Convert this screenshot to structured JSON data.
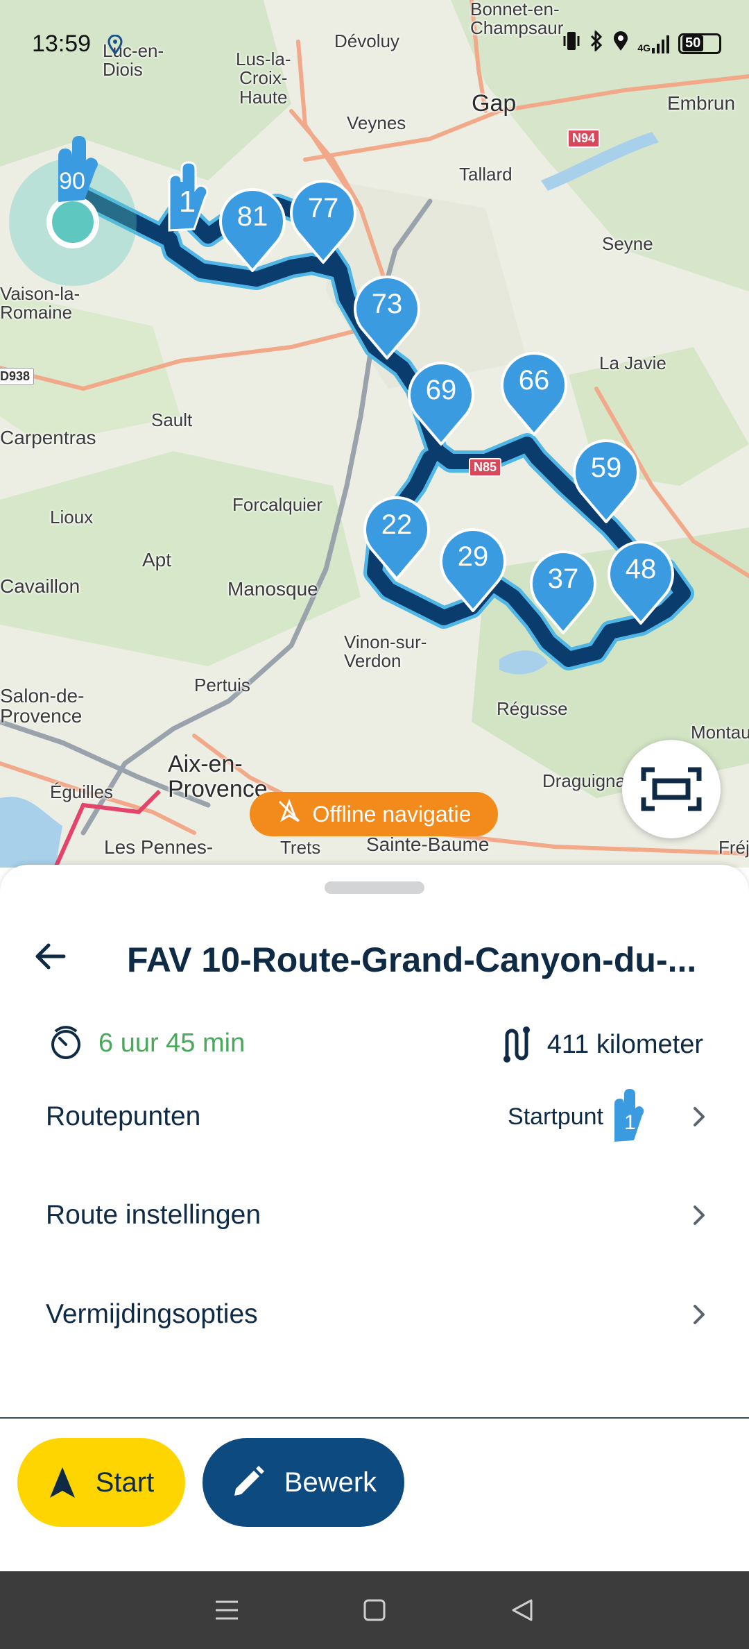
{
  "status_bar": {
    "time": "13:59",
    "network": "4G",
    "battery": "50"
  },
  "map": {
    "places": [
      {
        "name": "Luc-en-\nDiois"
      },
      {
        "name": "Lus-la-\nCroix-\nHaute"
      },
      {
        "name": "Dévoluy"
      },
      {
        "name": "Bonnet-en-\nChampsaur"
      },
      {
        "name": "Gap"
      },
      {
        "name": "Embrun"
      },
      {
        "name": "Veynes"
      },
      {
        "name": "Tallard"
      },
      {
        "name": "Seyne"
      },
      {
        "name": "Vaison-la-\nRomaine"
      },
      {
        "name": "Sault"
      },
      {
        "name": "Carpentras"
      },
      {
        "name": "La Javie"
      },
      {
        "name": "Forcalquier"
      },
      {
        "name": "Lioux"
      },
      {
        "name": "Apt"
      },
      {
        "name": "Manosque"
      },
      {
        "name": "Cavaillon"
      },
      {
        "name": "Vinon-sur-\nVerdon"
      },
      {
        "name": "Pertuis"
      },
      {
        "name": "Salon-de-\nProvence"
      },
      {
        "name": "Régusse"
      },
      {
        "name": "Aix-en-\nProvence"
      },
      {
        "name": "Éguilles"
      },
      {
        "name": "Draguignan"
      },
      {
        "name": "Montauroux"
      },
      {
        "name": "Les Pennes-"
      },
      {
        "name": "Trets"
      },
      {
        "name": "Sainte-Baume"
      },
      {
        "name": "Fréjus"
      }
    ],
    "road_badges": [
      "N94",
      "N85",
      "D938"
    ],
    "markers": [
      "90",
      "1",
      "81",
      "77",
      "73",
      "69",
      "66",
      "59",
      "22",
      "29",
      "37",
      "48"
    ],
    "offline_label": "Offline navigatie",
    "route_color": "#0a3d6e",
    "marker_color": "#3b9be0"
  },
  "route": {
    "title": "FAV 10-Route-Grand-Canyon-du-...",
    "duration": "6 uur 45 min",
    "distance": "411 kilometer",
    "rows": {
      "routepunten_label": "Routepunten",
      "routepunten_value": "Startpunt",
      "instellingen_label": "Route instellingen",
      "vermijding_label": "Vermijdingsopties"
    }
  },
  "actions": {
    "start_label": "Start",
    "edit_label": "Bewerk",
    "start_color": "#ffd500",
    "edit_color": "#0c4a80"
  }
}
